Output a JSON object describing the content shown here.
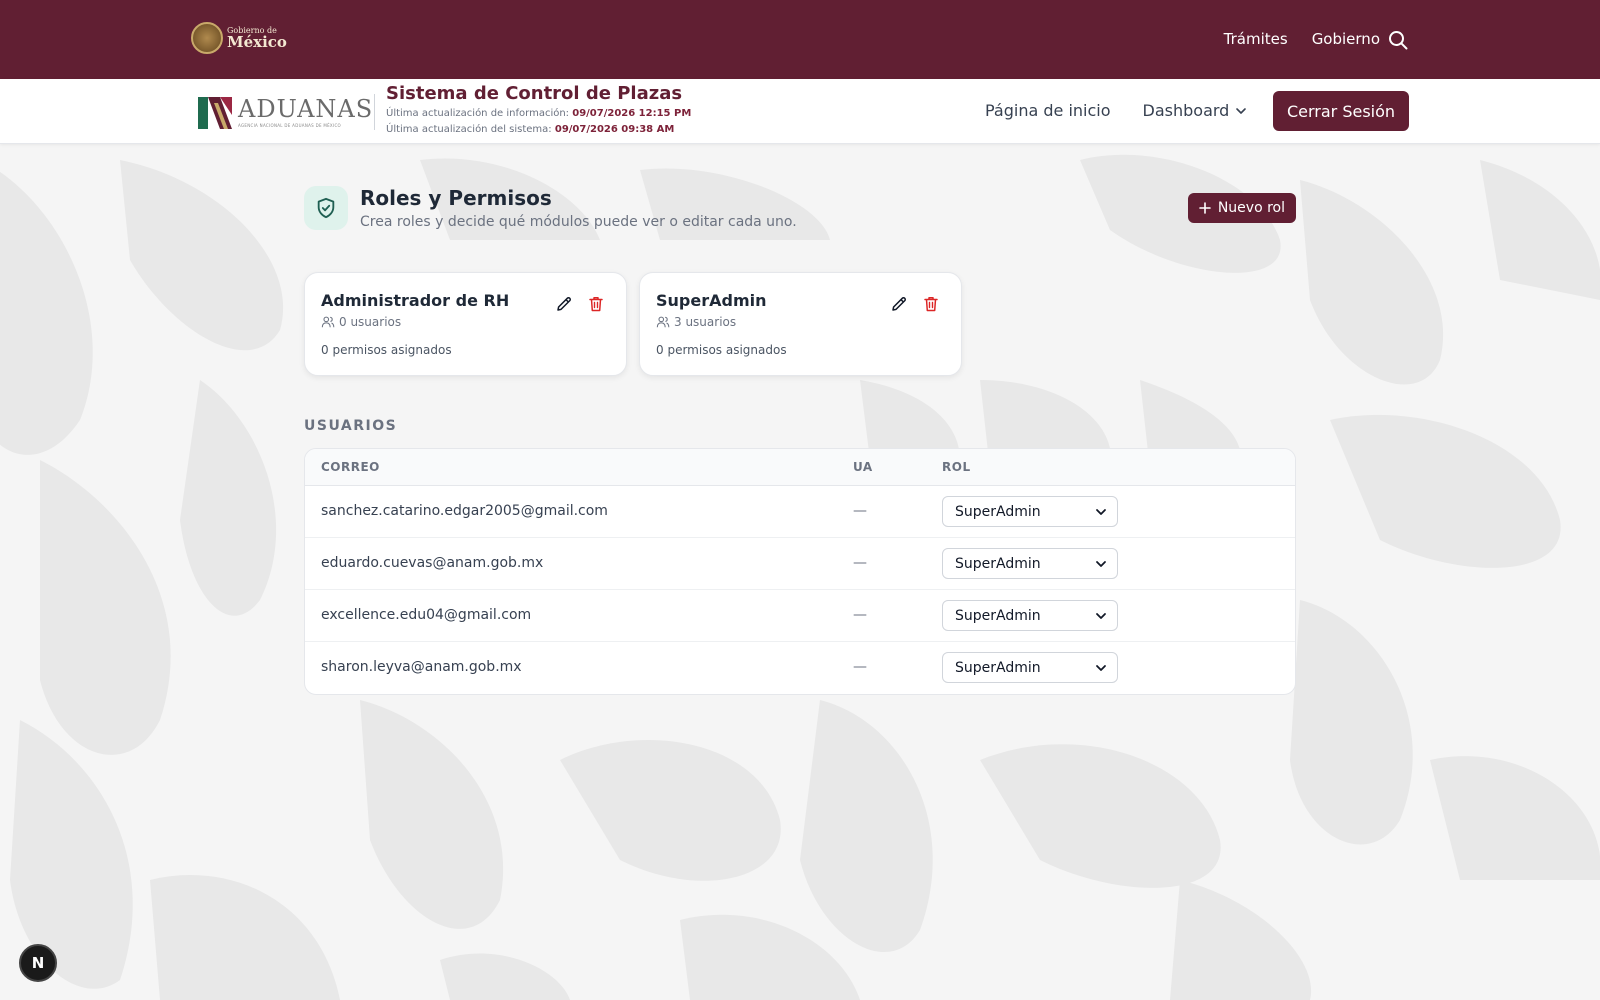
{
  "gov_bar": {
    "logo_small": "Gobierno de",
    "logo_big": "México",
    "nav": [
      "Trámites",
      "Gobierno"
    ],
    "search_icon": "search-icon"
  },
  "header": {
    "logo_name": "ADUANAS",
    "logo_sub": "AGENCIA NACIONAL DE ADUANAS DE MÉXICO",
    "system_title": "Sistema de Control de Plazas",
    "info_update_label": "Última actualización de información:",
    "info_update_value": "09/07/2026 12:15 PM",
    "system_update_label": "Última actualización del sistema:",
    "system_update_value": "09/07/2026 09:38 AM",
    "nav_home": "Página de inicio",
    "nav_dashboard": "Dashboard",
    "logout": "Cerrar Sesión"
  },
  "page": {
    "title": "Roles y Permisos",
    "subtitle": "Crea roles y decide qué módulos puede ver o editar cada uno.",
    "new_role_button": "Nuevo rol",
    "roles": [
      {
        "name": "Administrador de RH",
        "users": "0 usuarios",
        "permissions": "0 permisos asignados"
      },
      {
        "name": "SuperAdmin",
        "users": "3 usuarios",
        "permissions": "0 permisos asignados"
      }
    ],
    "users_section_label": "USUARIOS",
    "table": {
      "columns": [
        "CORREO",
        "UA",
        "ROL"
      ],
      "rows": [
        {
          "email": "sanchez.catarino.edgar2005@gmail.com",
          "ua": "—",
          "role": "SuperAdmin"
        },
        {
          "email": "eduardo.cuevas@anam.gob.mx",
          "ua": "—",
          "role": "SuperAdmin"
        },
        {
          "email": "excellence.edu04@gmail.com",
          "ua": "—",
          "role": "SuperAdmin"
        },
        {
          "email": "sharon.leyva@anam.gob.mx",
          "ua": "—",
          "role": "SuperAdmin"
        }
      ]
    }
  },
  "dev_badge": "N",
  "colors": {
    "brand": "#611f33",
    "accent_text": "#7d2239",
    "delete": "#dc2626",
    "shield_bg": "#dff2ec",
    "shield_stroke": "#1f5f52"
  }
}
